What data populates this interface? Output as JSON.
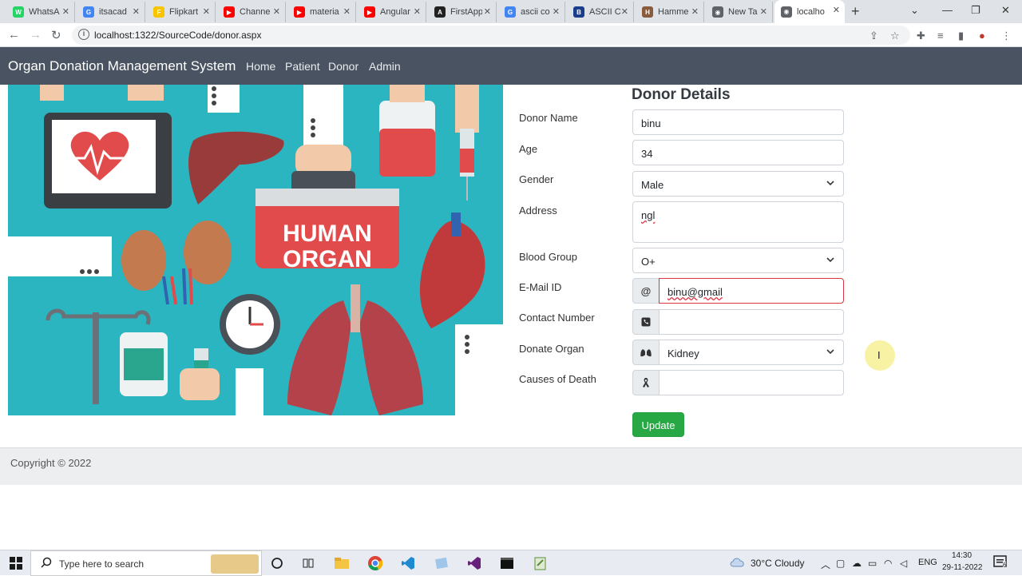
{
  "browser": {
    "tabs": [
      {
        "title": "WhatsA",
        "color": "#25d366",
        "glyph": "W"
      },
      {
        "title": "itsacad",
        "color": "#4285f4",
        "glyph": "G"
      },
      {
        "title": "Flipkart",
        "color": "#f7c600",
        "glyph": "F"
      },
      {
        "title": "Channe",
        "color": "#ff0000",
        "glyph": "▶"
      },
      {
        "title": "materia",
        "color": "#ff0000",
        "glyph": "▶"
      },
      {
        "title": "Angular",
        "color": "#ff0000",
        "glyph": "▶"
      },
      {
        "title": "FirstApp",
        "color": "#222222",
        "glyph": "A"
      },
      {
        "title": "ascii co",
        "color": "#4285f4",
        "glyph": "G"
      },
      {
        "title": "ASCII C",
        "color": "#1a3e8c",
        "glyph": "B"
      },
      {
        "title": "Hamme",
        "color": "#8a5a3c",
        "glyph": "H"
      },
      {
        "title": "New Ta",
        "color": "#5f6368",
        "glyph": "◉"
      },
      {
        "title": "localho",
        "color": "#5f6368",
        "glyph": "◉"
      }
    ],
    "url": "localhost:1322/SourceCode/donor.aspx"
  },
  "navbar": {
    "brand": "Organ Donation Management System",
    "links": [
      "Home",
      "Patient",
      "Donor",
      "Admin"
    ]
  },
  "hero": {
    "sign_line1": "HUMAN",
    "sign_line2": "ORGAN"
  },
  "form": {
    "title": "Donor Details",
    "labels": {
      "name": "Donor Name",
      "age": "Age",
      "gender": "Gender",
      "address": "Address",
      "blood": "Blood Group",
      "email": "E-Mail ID",
      "contact": "Contact Number",
      "organ": "Donate Organ",
      "death": "Causes of Death"
    },
    "values": {
      "name": "binu",
      "age": "34",
      "gender": "Male",
      "address": "ngl",
      "blood": "O+",
      "email": "binu@gmail",
      "contact": "",
      "organ": "Kidney",
      "death": ""
    },
    "email_addon": "@",
    "update_label": "Update"
  },
  "footer": {
    "copyright": "Copyright © 2022"
  },
  "taskbar": {
    "search_placeholder": "Type here to search",
    "weather": "30°C  Cloudy",
    "lang": "ENG",
    "time": "14:30",
    "date": "29-11-2022",
    "notifications": "6"
  }
}
